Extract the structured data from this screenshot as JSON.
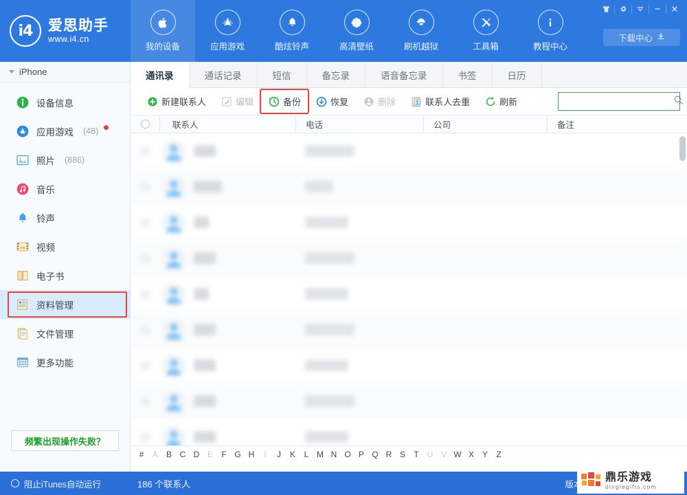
{
  "brand": {
    "logo_text": "i4",
    "name_cn": "爱思助手",
    "url": "www.i4.cn"
  },
  "header": {
    "nav": [
      {
        "label": "我的设备",
        "icon": "apple-icon",
        "active": true
      },
      {
        "label": "应用游戏",
        "icon": "appstore-icon",
        "active": false
      },
      {
        "label": "酷炫铃声",
        "icon": "bell-icon",
        "active": false
      },
      {
        "label": "高清壁纸",
        "icon": "flower-icon",
        "active": false
      },
      {
        "label": "刷机越狱",
        "icon": "box-icon",
        "active": false
      },
      {
        "label": "工具箱",
        "icon": "tools-icon",
        "active": false
      },
      {
        "label": "教程中心",
        "icon": "info-icon",
        "active": false
      }
    ],
    "window_buttons": [
      {
        "name": "skin-icon",
        "glyph": "👕"
      },
      {
        "name": "settings-gear-icon",
        "glyph": "✿"
      },
      {
        "name": "menu-chevron-icon",
        "glyph": "▾"
      },
      {
        "name": "minimize-icon",
        "glyph": "—"
      },
      {
        "name": "close-icon",
        "glyph": "✕"
      }
    ],
    "download_center": {
      "label": "下载中心",
      "icon": "download-icon"
    }
  },
  "sidebar": {
    "device": {
      "label": "iPhone"
    },
    "items": [
      {
        "label": "设备信息",
        "icon": "info-circle-icon",
        "count": "",
        "badge": false,
        "selected": false
      },
      {
        "label": "应用游戏",
        "icon": "appstore-circle-icon",
        "count": "(48)",
        "badge": true,
        "selected": false
      },
      {
        "label": "照片",
        "icon": "photo-icon",
        "count": "(886)",
        "badge": false,
        "selected": false
      },
      {
        "label": "音乐",
        "icon": "music-icon",
        "count": "",
        "badge": false,
        "selected": false
      },
      {
        "label": "铃声",
        "icon": "ringtone-bell-icon",
        "count": "",
        "badge": false,
        "selected": false
      },
      {
        "label": "视频",
        "icon": "video-icon",
        "count": "",
        "badge": false,
        "selected": false
      },
      {
        "label": "电子书",
        "icon": "book-icon",
        "count": "",
        "badge": false,
        "selected": false
      },
      {
        "label": "资料管理",
        "icon": "data-manage-icon",
        "count": "",
        "badge": false,
        "selected": true
      },
      {
        "label": "文件管理",
        "icon": "file-manage-icon",
        "count": "",
        "badge": false,
        "selected": false
      },
      {
        "label": "更多功能",
        "icon": "more-features-icon",
        "count": "",
        "badge": false,
        "selected": false
      }
    ],
    "help_button": "频繁出现操作失败？"
  },
  "main": {
    "tabs": [
      {
        "label": "通讯录",
        "active": true
      },
      {
        "label": "通话记录",
        "active": false
      },
      {
        "label": "短信",
        "active": false
      },
      {
        "label": "备忘录",
        "active": false
      },
      {
        "label": "语音备忘录",
        "active": false
      },
      {
        "label": "书签",
        "active": false
      },
      {
        "label": "日历",
        "active": false
      }
    ],
    "toolbar": [
      {
        "label": "新建联系人",
        "icon": "add-contact-icon",
        "disabled": false,
        "highlight": false
      },
      {
        "label": "编辑",
        "icon": "edit-icon",
        "disabled": true,
        "highlight": false
      },
      {
        "label": "备份",
        "icon": "backup-icon",
        "disabled": false,
        "highlight": true
      },
      {
        "label": "恢复",
        "icon": "restore-icon",
        "disabled": false,
        "highlight": false
      },
      {
        "label": "删除",
        "icon": "delete-icon",
        "disabled": true,
        "highlight": false
      },
      {
        "label": "联系人去重",
        "icon": "dedupe-icon",
        "disabled": false,
        "highlight": false
      },
      {
        "label": "刷新",
        "icon": "refresh-icon",
        "disabled": false,
        "highlight": false
      }
    ],
    "search": {
      "value": "",
      "placeholder": "",
      "icon": "search-icon"
    },
    "table": {
      "select_all_icon": "select-all-circle",
      "columns": [
        "联系人",
        "电话",
        "公司",
        "备注"
      ],
      "rows": [
        {
          "name": "███",
          "phone": "███ ████",
          "company": "",
          "note": ""
        },
        {
          "name": "████",
          "phone": "████",
          "company": "",
          "note": ""
        },
        {
          "name": "██",
          "phone": "███ ███",
          "company": "",
          "note": ""
        },
        {
          "name": "███",
          "phone": "███ ████",
          "company": "",
          "note": ""
        },
        {
          "name": "██",
          "phone": "███ ███",
          "company": "",
          "note": ""
        },
        {
          "name": "███",
          "phone": "███ ████",
          "company": "",
          "note": ""
        },
        {
          "name": "███",
          "phone": "███ ███",
          "company": "",
          "note": ""
        },
        {
          "name": "███",
          "phone": "███ ████",
          "company": "",
          "note": ""
        },
        {
          "name": "███",
          "phone": "███ ███",
          "company": "",
          "note": ""
        }
      ]
    },
    "alphabet": [
      {
        "ch": "#",
        "dim": false
      },
      {
        "ch": "A",
        "dim": true
      },
      {
        "ch": "B",
        "dim": false
      },
      {
        "ch": "C",
        "dim": false
      },
      {
        "ch": "D",
        "dim": false
      },
      {
        "ch": "E",
        "dim": true
      },
      {
        "ch": "F",
        "dim": false
      },
      {
        "ch": "G",
        "dim": false
      },
      {
        "ch": "H",
        "dim": false
      },
      {
        "ch": "I",
        "dim": true
      },
      {
        "ch": "J",
        "dim": false
      },
      {
        "ch": "K",
        "dim": false
      },
      {
        "ch": "L",
        "dim": false
      },
      {
        "ch": "M",
        "dim": false
      },
      {
        "ch": "N",
        "dim": false
      },
      {
        "ch": "O",
        "dim": false
      },
      {
        "ch": "P",
        "dim": false
      },
      {
        "ch": "Q",
        "dim": false
      },
      {
        "ch": "R",
        "dim": false
      },
      {
        "ch": "S",
        "dim": false
      },
      {
        "ch": "T",
        "dim": false
      },
      {
        "ch": "U",
        "dim": true
      },
      {
        "ch": "V",
        "dim": true
      },
      {
        "ch": "W",
        "dim": false
      },
      {
        "ch": "X",
        "dim": false
      },
      {
        "ch": "Y",
        "dim": false
      },
      {
        "ch": "Z",
        "dim": false
      }
    ]
  },
  "statusbar": {
    "itunes_toggle": "阻止iTunes自动运行",
    "contact_count": "186 个联系人",
    "version_label": "版本号"
  },
  "watermark": {
    "name_cn": "鼎乐游戏",
    "name_en": "dinglegifts.com"
  },
  "colors": {
    "brand_blue": "#2d79e0",
    "status_blue": "#2b6fd8",
    "highlight_red": "#e8433c",
    "selected_blue": "#d9ecfb",
    "search_border_green": "#3faa55",
    "help_green": "#1f9e2e"
  }
}
